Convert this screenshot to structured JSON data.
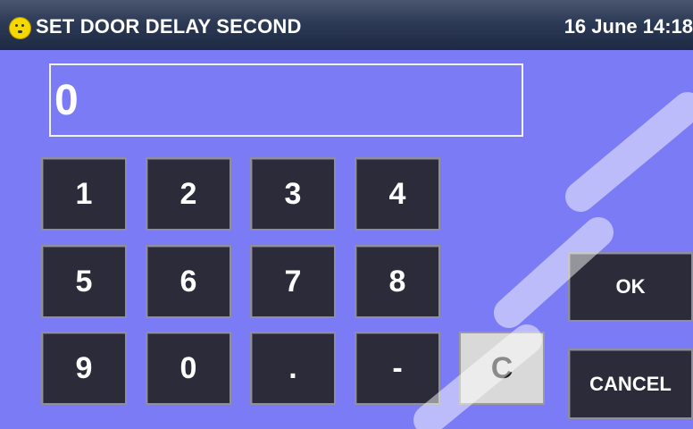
{
  "header": {
    "title": "SET DOOR DELAY SECOND",
    "datetime": "16 June 14:18",
    "icon": "smiley-icon",
    "background_color": "#26324d",
    "text_color": "#ffffff"
  },
  "display": {
    "value": "0",
    "border_color": "#f2f2f2"
  },
  "keypad": {
    "keys": [
      "1",
      "2",
      "3",
      "4",
      "5",
      "6",
      "7",
      "8",
      "9",
      "0",
      ".",
      "-"
    ],
    "clear_label": "C",
    "ok_label": "OK",
    "cancel_label": "CANCEL",
    "key_color": "#2c2b3a",
    "clear_key_color": "#d9d9d9"
  },
  "theme": {
    "background_color": "#7b7bf5"
  }
}
